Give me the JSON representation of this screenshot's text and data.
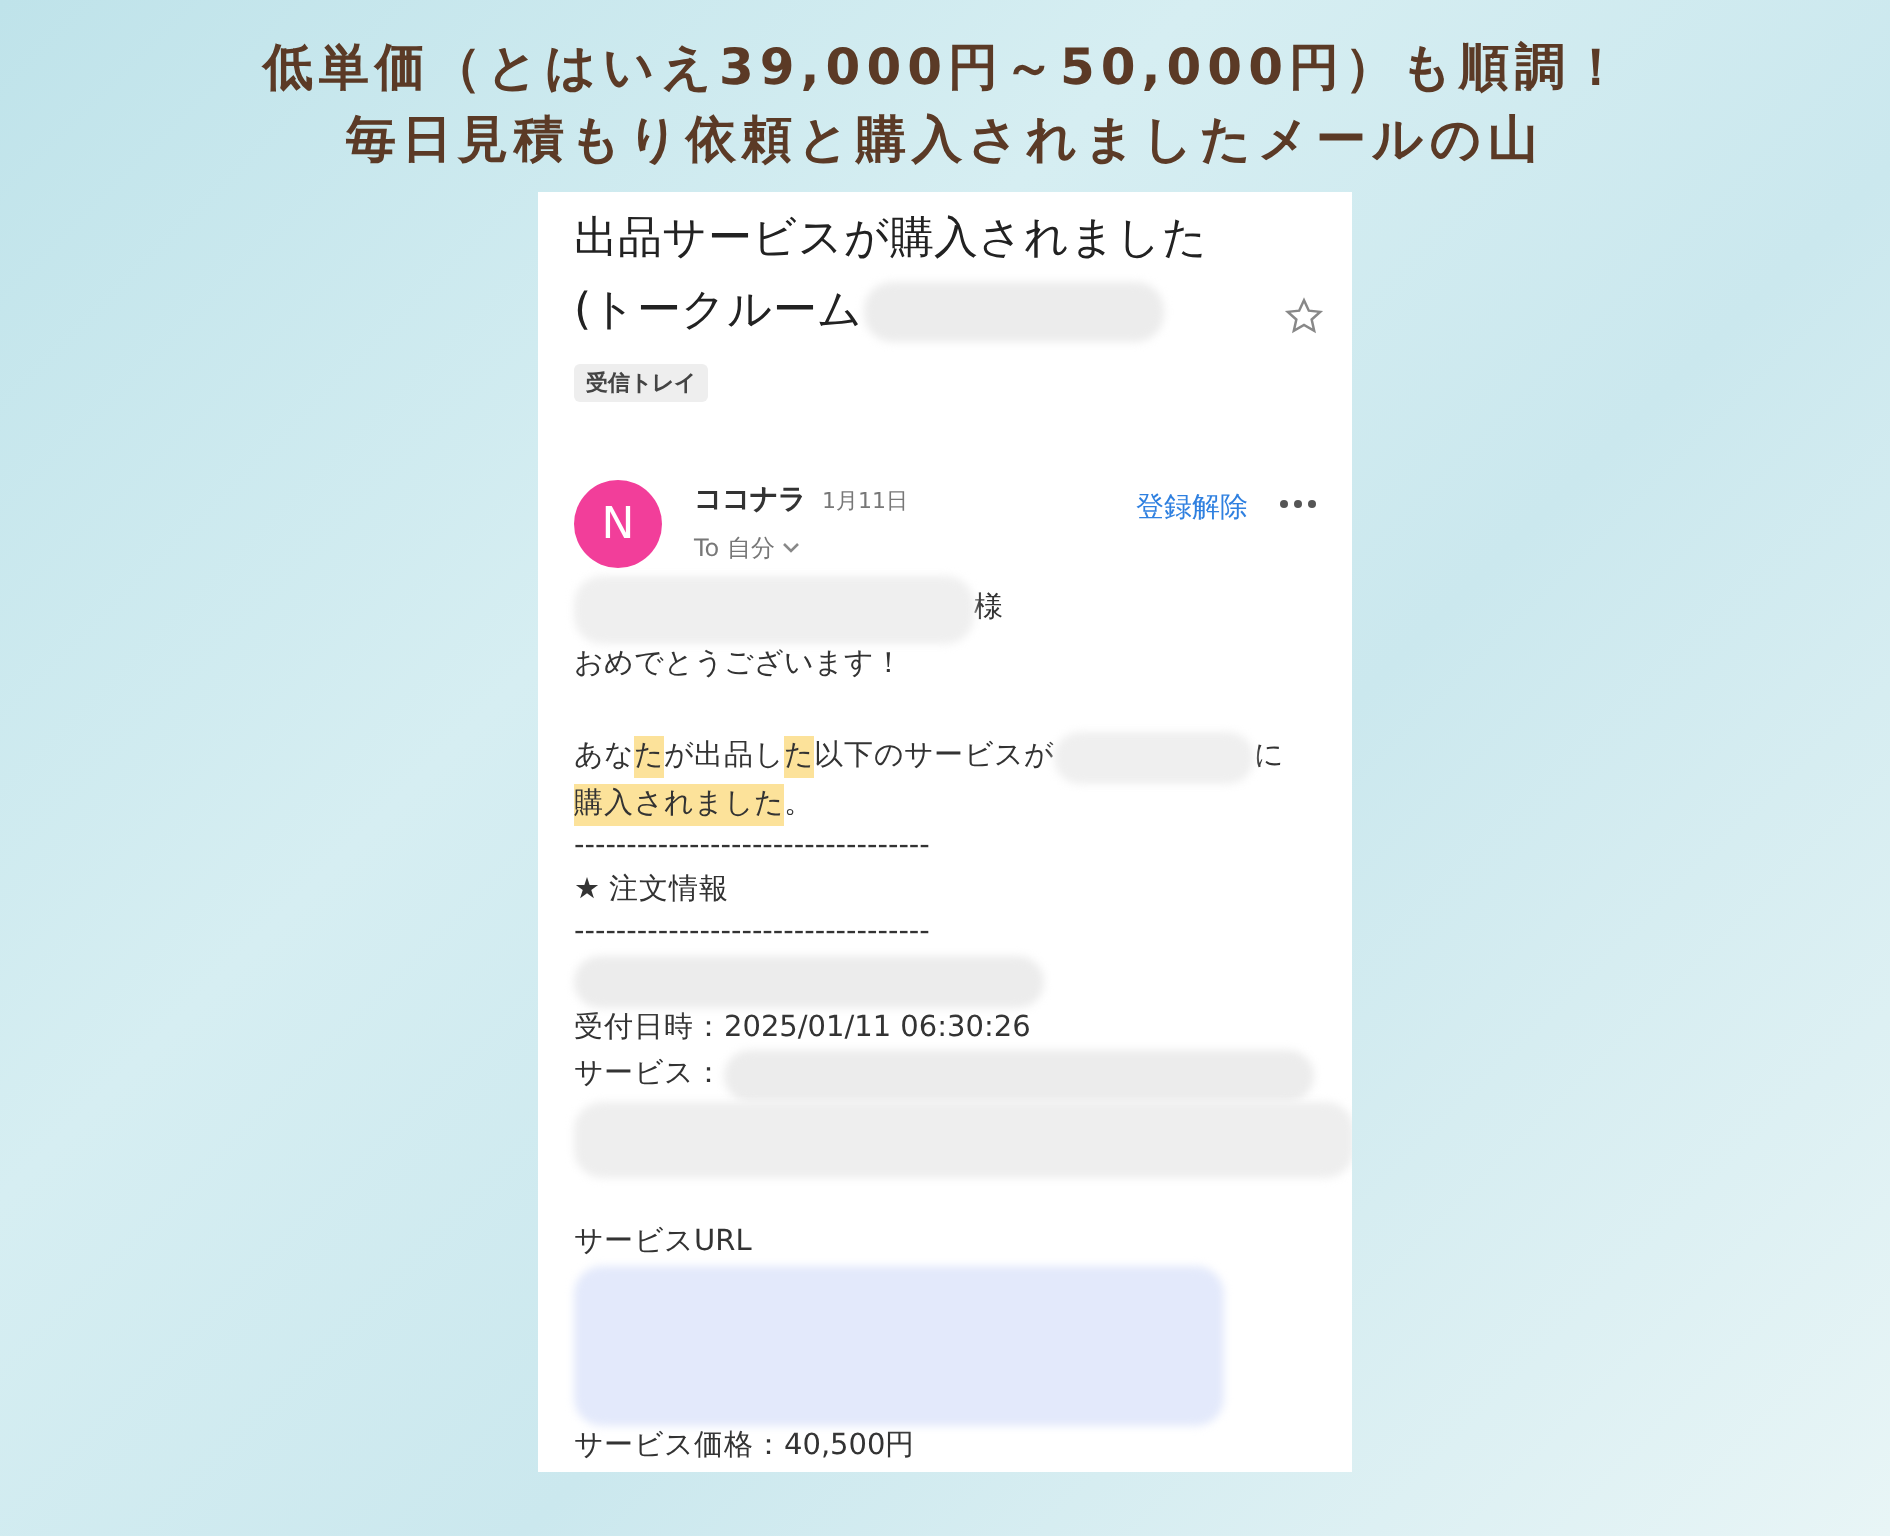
{
  "headline": [
    "低単価（とはいえ39,000円～50,000円）も順調！",
    "毎日見積もり依頼と購入されましたメールの山"
  ],
  "email": {
    "subject_lines": [
      [
        {
          "kind": "text",
          "text": "出品サービスが購入されました"
        }
      ],
      [
        {
          "kind": "text",
          "text": "(トークルーム"
        },
        {
          "kind": "redacted"
        }
      ]
    ],
    "starred": false,
    "label": "受信トレイ",
    "sender": {
      "avatar_letter": "N",
      "name": "ココナラ",
      "date": "1月11日",
      "recipient": "To 自分",
      "unsubscribe": "登録解除"
    },
    "body": [
      {
        "kind": "line",
        "parts": [
          {
            "kind": "redacted"
          },
          {
            "kind": "text",
            "text": "様",
            "highlighted": false
          }
        ]
      },
      {
        "kind": "line",
        "parts": [
          {
            "kind": "text",
            "text": "おめでとうございます！",
            "highlighted": false
          }
        ]
      },
      {
        "kind": "gap"
      },
      {
        "kind": "line",
        "parts": [
          {
            "kind": "text",
            "text": "あな",
            "highlighted": false
          },
          {
            "kind": "text",
            "text": "た",
            "highlighted": true
          },
          {
            "kind": "text",
            "text": "が出品し",
            "highlighted": false
          },
          {
            "kind": "text",
            "text": "た",
            "highlighted": true
          },
          {
            "kind": "text",
            "text": "以下のサービスが",
            "highlighted": false
          },
          {
            "kind": "redacted"
          },
          {
            "kind": "text",
            "text": "に",
            "highlighted": false
          }
        ]
      },
      {
        "kind": "line",
        "parts": [
          {
            "kind": "text",
            "text": "購入されました",
            "highlighted": true
          },
          {
            "kind": "text",
            "text": "。",
            "highlighted": false
          }
        ]
      },
      {
        "kind": "line",
        "parts": [
          {
            "kind": "text",
            "text": "----------------------------------",
            "highlighted": false
          }
        ]
      },
      {
        "kind": "line",
        "parts": [
          {
            "kind": "text",
            "text": "★ 注文情報",
            "highlighted": false
          }
        ]
      },
      {
        "kind": "line",
        "parts": [
          {
            "kind": "text",
            "text": "----------------------------------",
            "highlighted": false
          }
        ]
      },
      {
        "kind": "line",
        "parts": [
          {
            "kind": "redacted"
          }
        ]
      },
      {
        "kind": "line",
        "parts": [
          {
            "kind": "text",
            "text": "受付日時：2025/01/11 06:30:26",
            "highlighted": false
          }
        ]
      },
      {
        "kind": "line",
        "parts": [
          {
            "kind": "text",
            "text": "サービス：",
            "highlighted": false
          },
          {
            "kind": "redacted"
          }
        ]
      },
      {
        "kind": "line",
        "parts": [
          {
            "kind": "redacted"
          }
        ]
      },
      {
        "kind": "gap"
      },
      {
        "kind": "line",
        "parts": [
          {
            "kind": "text",
            "text": "サービスURL",
            "highlighted": false
          }
        ]
      },
      {
        "kind": "line",
        "parts": [
          {
            "kind": "redacted"
          }
        ]
      },
      {
        "kind": "line",
        "parts": [
          {
            "kind": "text",
            "text": "サービス価格：40,500円",
            "highlighted": false
          }
        ]
      }
    ]
  }
}
